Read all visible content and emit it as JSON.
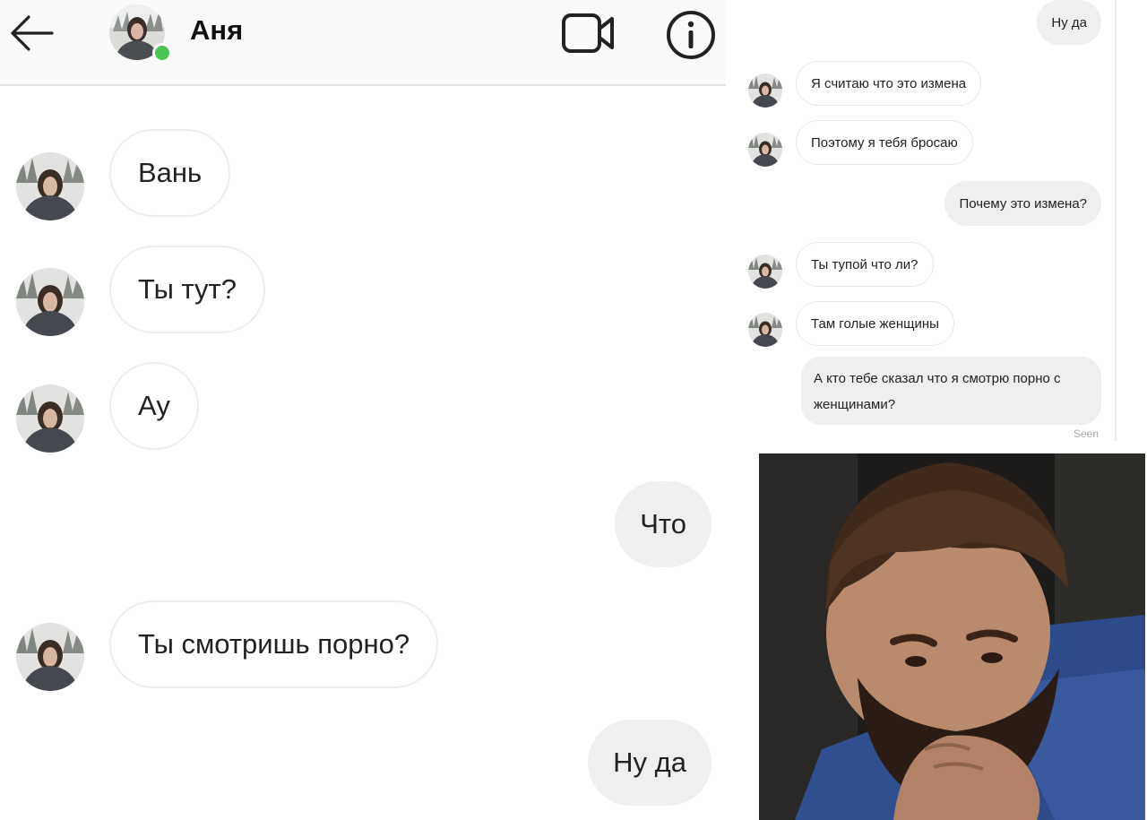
{
  "chat_main": {
    "contact_name": "Аня",
    "status_color": "#4cc552",
    "icons": [
      "arrow-left-icon",
      "video-call-icon",
      "info-icon"
    ],
    "messages": [
      {
        "from": "contact",
        "text": "Вань"
      },
      {
        "from": "contact",
        "text": "Ты тут?"
      },
      {
        "from": "contact",
        "text": "Ау"
      },
      {
        "from": "me",
        "text": "Что"
      },
      {
        "from": "contact",
        "text": "Ты смотришь порно?"
      },
      {
        "from": "me",
        "text": "Ну да"
      }
    ]
  },
  "chat_continued": {
    "messages": [
      {
        "from": "me",
        "text": "Ну да"
      },
      {
        "from": "contact",
        "text": "Я считаю что это измена"
      },
      {
        "from": "contact",
        "text": "Поэтому я тебя бросаю"
      },
      {
        "from": "me",
        "text": "Почему это измена?"
      },
      {
        "from": "contact",
        "text": "Ты тупой что ли?"
      },
      {
        "from": "contact",
        "text": "Там голые женщины"
      },
      {
        "from": "me",
        "text": "А кто тебе сказал что я смотрю порно с женщинами?"
      }
    ],
    "seen_label": "Seen"
  },
  "colors": {
    "incoming_bubble_border": "#eeeeee",
    "outgoing_bubble": "#efefef",
    "header_bg": "#fafafa"
  }
}
